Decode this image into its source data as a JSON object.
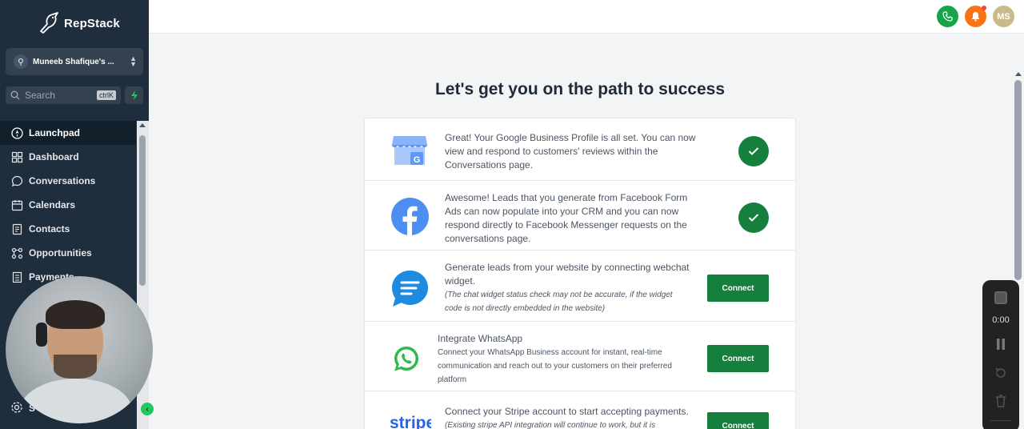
{
  "app": {
    "brand": "RepStack"
  },
  "account": {
    "name": "Muneeb Shafique's ..."
  },
  "search": {
    "label": "Search",
    "shortcut": "ctrlK"
  },
  "nav": {
    "items": [
      {
        "label": "Launchpad",
        "icon": "rocket-icon",
        "active": true
      },
      {
        "label": "Dashboard",
        "icon": "grid-icon"
      },
      {
        "label": "Conversations",
        "icon": "chat-bubble-icon"
      },
      {
        "label": "Calendars",
        "icon": "calendar-icon"
      },
      {
        "label": "Contacts",
        "icon": "contacts-icon"
      },
      {
        "label": "Opportunities",
        "icon": "opportunities-icon"
      },
      {
        "label": "Payments",
        "icon": "payments-icon"
      }
    ],
    "settings_label": "S"
  },
  "topbar": {
    "avatar_initials": "MS"
  },
  "main": {
    "headline": "Let's get you on the path to success",
    "rows": [
      {
        "icon": "google-business-icon",
        "lines": [
          "Great! Your Google Business Profile is all set. You can now",
          "view and respond to customers' reviews within the",
          "Conversations page."
        ],
        "status": "done"
      },
      {
        "icon": "facebook-icon",
        "lines": [
          "Awesome! Leads that you generate from Facebook Form",
          "Ads can now populate into your CRM and you can now",
          "respond directly to Facebook Messenger requests on the",
          "conversations page."
        ],
        "status": "done"
      },
      {
        "icon": "webchat-icon",
        "lines": [
          "Generate leads from your website by connecting webchat",
          "widget."
        ],
        "note": [
          "(The chat widget status check may not be accurate, if the widget",
          "code is not directly embedded in the website)"
        ],
        "button": "Connect"
      },
      {
        "icon": "whatsapp-icon",
        "title": "Integrate WhatsApp",
        "small": [
          "Connect your WhatsApp Business account for instant, real-time",
          "communication and reach out to your customers on their preferred",
          "platform"
        ],
        "button": "Connect"
      },
      {
        "icon": "stripe-icon",
        "logo_text": "stripe",
        "lines": [
          "Connect your Stripe account to start accepting payments."
        ],
        "note": [
          "(Existing stripe API integration will continue to work, but it is"
        ],
        "button": "Connect"
      }
    ]
  },
  "recorder": {
    "time": "0:00"
  },
  "colors": {
    "sidebar": "#1f2e3d",
    "accent_green": "#15803d",
    "bell": "#f97316"
  }
}
